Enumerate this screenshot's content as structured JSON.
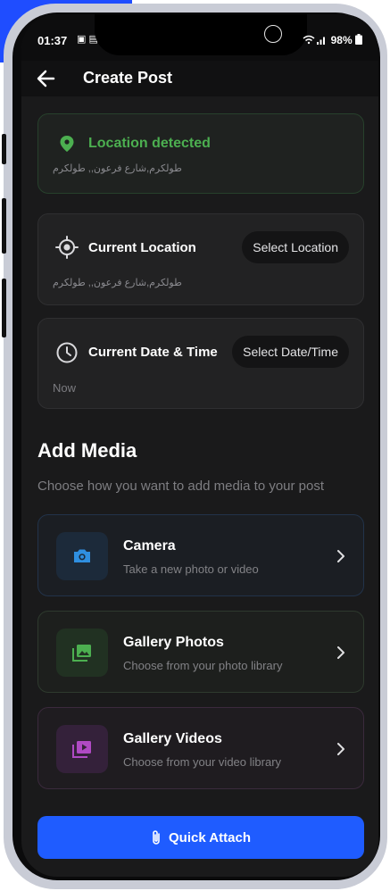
{
  "status_bar": {
    "time": "01:37",
    "left_icons": "▣ ▤",
    "battery": "98%"
  },
  "app_bar": {
    "back_icon": "arrow-left-icon",
    "title": "Create Post"
  },
  "location_detected": {
    "icon": "map-pin-icon",
    "title": "Location detected",
    "address": "طولكرم,شارع فرعون,, طولكرم",
    "color": "#4caf50"
  },
  "current_location": {
    "icon": "crosshair-icon",
    "title": "Current Location",
    "button_label": "Select Location",
    "address": "طولكرم,شارع فرعون,, طولكرم"
  },
  "current_datetime": {
    "icon": "clock-icon",
    "title": "Current Date & Time",
    "button_label": "Select Date/Time",
    "value": "Now"
  },
  "add_media": {
    "title": "Add Media",
    "subtitle": "Choose how you want to add media to your post",
    "options": [
      {
        "title": "Camera",
        "description": "Take a new photo or video",
        "icon": "camera-icon",
        "accent": "#2f8fe0"
      },
      {
        "title": "Gallery Photos",
        "description": "Choose from your photo library",
        "icon": "image-icon",
        "accent": "#4caf50"
      },
      {
        "title": "Gallery Videos",
        "description": "Choose from your video library",
        "icon": "video-library-icon",
        "accent": "#b04ac4"
      }
    ]
  },
  "quick_attach": {
    "label": "Quick Attach",
    "icon": "paperclip-icon",
    "color": "#1f5cff"
  }
}
